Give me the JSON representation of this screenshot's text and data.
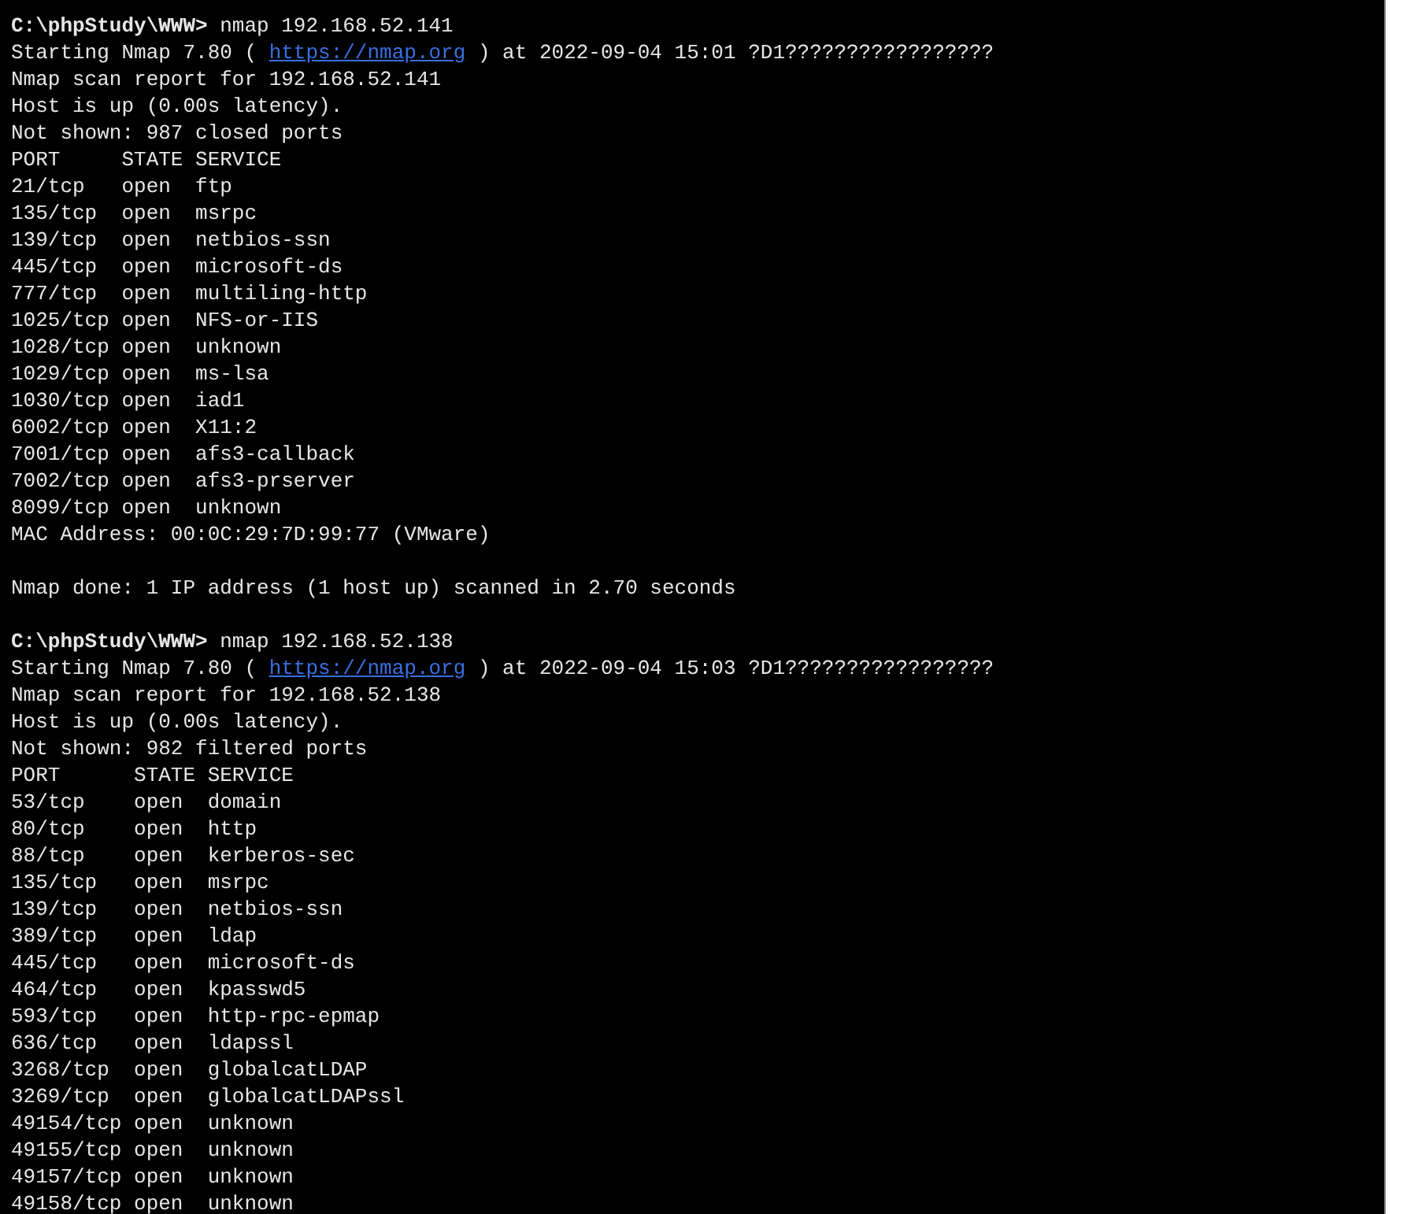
{
  "terminal": {
    "lines": [
      {
        "kind": "text",
        "text": "**C:\\phpStudy\\WWW>** nmap 192.168.52.141"
      },
      {
        "kind": "link",
        "before": "Starting Nmap 7.80 ( ",
        "link": "https://nmap.org",
        "after": " ) at 2022-09-04 15:01 ?D1?????????????????"
      },
      {
        "kind": "text",
        "text": "Nmap scan report for 192.168.52.141"
      },
      {
        "kind": "text",
        "text": "Host is up (0.00s latency)."
      },
      {
        "kind": "text",
        "text": "Not shown: 987 closed ports"
      },
      {
        "kind": "text",
        "text": "PORT     STATE SERVICE"
      },
      {
        "kind": "text",
        "text": "21/tcp   open  ftp"
      },
      {
        "kind": "text",
        "text": "135/tcp  open  msrpc"
      },
      {
        "kind": "text",
        "text": "139/tcp  open  netbios-ssn"
      },
      {
        "kind": "text",
        "text": "445/tcp  open  microsoft-ds"
      },
      {
        "kind": "text",
        "text": "777/tcp  open  multiling-http"
      },
      {
        "kind": "text",
        "text": "1025/tcp open  NFS-or-IIS"
      },
      {
        "kind": "text",
        "text": "1028/tcp open  unknown"
      },
      {
        "kind": "text",
        "text": "1029/tcp open  ms-lsa"
      },
      {
        "kind": "text",
        "text": "1030/tcp open  iad1"
      },
      {
        "kind": "text",
        "text": "6002/tcp open  X11:2"
      },
      {
        "kind": "text",
        "text": "7001/tcp open  afs3-callback"
      },
      {
        "kind": "text",
        "text": "7002/tcp open  afs3-prserver"
      },
      {
        "kind": "text",
        "text": "8099/tcp open  unknown"
      },
      {
        "kind": "text",
        "text": "MAC Address: 00:0C:29:7D:99:77 (VMware)"
      },
      {
        "kind": "blank"
      },
      {
        "kind": "text",
        "text": "Nmap done: 1 IP address (1 host up) scanned in 2.70 seconds"
      },
      {
        "kind": "blank"
      },
      {
        "kind": "text",
        "text": "**C:\\phpStudy\\WWW>** nmap 192.168.52.138"
      },
      {
        "kind": "link",
        "before": "Starting Nmap 7.80 ( ",
        "link": "https://nmap.org",
        "after": " ) at 2022-09-04 15:03 ?D1?????????????????"
      },
      {
        "kind": "text",
        "text": "Nmap scan report for 192.168.52.138"
      },
      {
        "kind": "text",
        "text": "Host is up (0.00s latency)."
      },
      {
        "kind": "text",
        "text": "Not shown: 982 filtered ports"
      },
      {
        "kind": "text",
        "text": "PORT      STATE SERVICE"
      },
      {
        "kind": "text",
        "text": "53/tcp    open  domain"
      },
      {
        "kind": "text",
        "text": "80/tcp    open  http"
      },
      {
        "kind": "text",
        "text": "88/tcp    open  kerberos-sec"
      },
      {
        "kind": "text",
        "text": "135/tcp   open  msrpc"
      },
      {
        "kind": "text",
        "text": "139/tcp   open  netbios-ssn"
      },
      {
        "kind": "text",
        "text": "389/tcp   open  ldap"
      },
      {
        "kind": "text",
        "text": "445/tcp   open  microsoft-ds"
      },
      {
        "kind": "text",
        "text": "464/tcp   open  kpasswd5"
      },
      {
        "kind": "text",
        "text": "593/tcp   open  http-rpc-epmap"
      },
      {
        "kind": "text",
        "text": "636/tcp   open  ldapssl"
      },
      {
        "kind": "text",
        "text": "3268/tcp  open  globalcatLDAP"
      },
      {
        "kind": "text",
        "text": "3269/tcp  open  globalcatLDAPssl"
      },
      {
        "kind": "text",
        "text": "49154/tcp open  unknown"
      },
      {
        "kind": "text",
        "text": "49155/tcp open  unknown"
      },
      {
        "kind": "text",
        "text": "49157/tcp open  unknown"
      },
      {
        "kind": "text",
        "text": "49158/tcp open  unknown"
      }
    ]
  }
}
